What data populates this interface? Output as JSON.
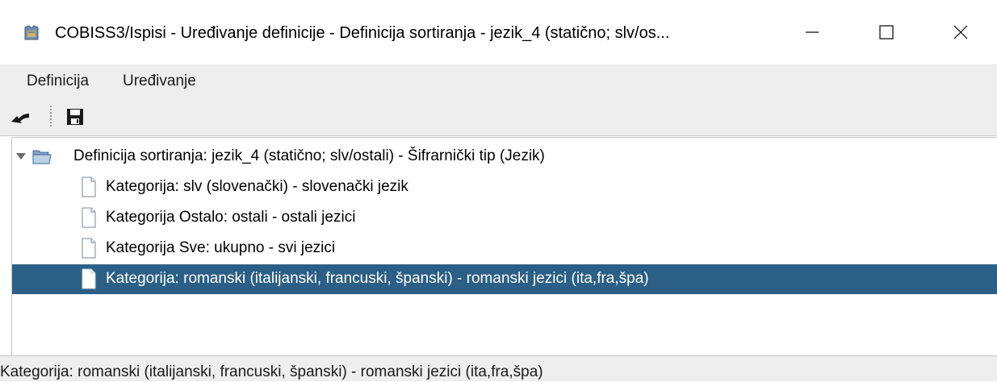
{
  "window": {
    "title": "COBISS3/Ispisi - Uređivanje definicije - Definicija sortiranja - jezik_4 (statično; slv/os...",
    "icons": [
      "cobiss-app-icon",
      "minimize-icon",
      "maximize-icon",
      "close-icon"
    ]
  },
  "menu": {
    "items": [
      "Definicija",
      "Uređivanje"
    ]
  },
  "toolbar": {
    "buttons": [
      "back-icon",
      "save-icon"
    ]
  },
  "tree": {
    "root": {
      "label": "Definicija sortiranja: jezik_4 (statično; slv/ostali) - Šifrarnički tip (Jezik)",
      "expanded": true,
      "icon": "open-folder-icon"
    },
    "children": [
      {
        "label": "Kategorija: slv (slovenački) - slovenački jezik",
        "icon": "file-icon",
        "selected": false
      },
      {
        "label": "Kategorija Ostalo: ostali - ostali jezici",
        "icon": "file-icon",
        "selected": false
      },
      {
        "label": "Kategorija Sve: ukupno - svi jezici",
        "icon": "file-icon",
        "selected": false
      },
      {
        "label": "Kategorija: romanski (italijanski, francuski, španski) - romanski jezici (ita,fra,špa)",
        "icon": "file-icon",
        "selected": true
      }
    ]
  },
  "status": {
    "text": "Kategorija: romanski (italijanski, francuski, španski) - romanski jezici (ita,fra,špa)"
  },
  "colors": {
    "selection": "#2b5f86",
    "chrome": "#eeeeee"
  }
}
